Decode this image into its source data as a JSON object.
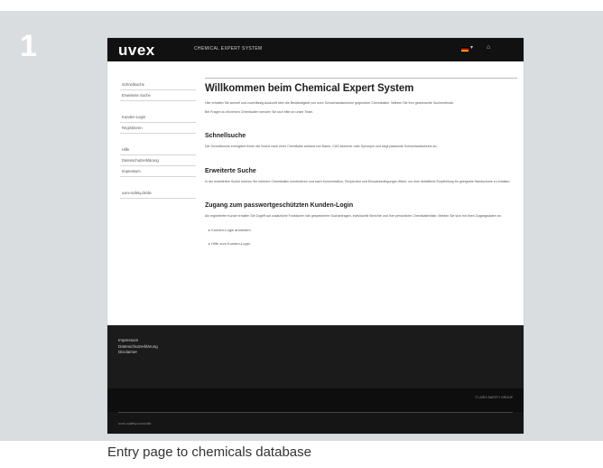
{
  "step": "1",
  "app": {
    "logo": "uvex",
    "title": "CHEMICAL EXPERT SYSTEM"
  },
  "sidebar": {
    "group1": [
      "Schnellsuche",
      "Erweiterte Suche"
    ],
    "group2": [
      "Kunden-Login",
      "Registrieren"
    ],
    "group3": [
      "Hilfe",
      "Datenschutzerklärung",
      "Impressum"
    ],
    "group4": [
      "uvex-safety.de/de"
    ]
  },
  "content": {
    "title": "Willkommen beim Chemical Expert System",
    "intro1": "Hier erhalten Sie schnell und zuverlässig Auskunft über die Beständigkeit von uvex Schutzhandschuhen gegenüber Chemikalien. Wählen Sie Ihre gewünschte Suchmethode.",
    "intro2": "Bei Fragen zu einzelnen Chemikalien wenden Sie sich bitte an unser Team.",
    "section1_title": "Schnellsuche",
    "section1_text": "Die Schnellsuche ermöglicht Ihnen die Suche nach einer Chemikalie anhand von Name, CAS-Nummer oder Synonym und zeigt passende Schutzhandschuhe an.",
    "section2_title": "Erweiterte Suche",
    "section2_text": "In der erweiterten Suche können Sie mehrere Chemikalien kombinieren und nach Konzentration, Temperatur und Einsatzbedingungen filtern, um eine detaillierte Empfehlung für geeignete Handschuhe zu erhalten.",
    "section3_title": "Zugang zum passwortgeschützten Kunden-Login",
    "section3_text": "Als registrierter Kunde erhalten Sie Zugriff auf zusätzliche Funktionen wie gespeicherte Suchanfragen, individuelle Berichte und Ihre persönliche Chemikalienliste. Melden Sie sich mit Ihren Zugangsdaten an.",
    "links": [
      "Kunden-Login anmelden",
      "Hilfe zum Kunden-Login"
    ]
  },
  "footer": {
    "links": [
      "Impressum",
      "Datenschutzerklärung",
      "Disclaimer"
    ],
    "copyright": "© UVEX SAFETY GROUP",
    "url": "uvex-safety.com/cdb"
  },
  "caption": "Entry page to chemicals database"
}
